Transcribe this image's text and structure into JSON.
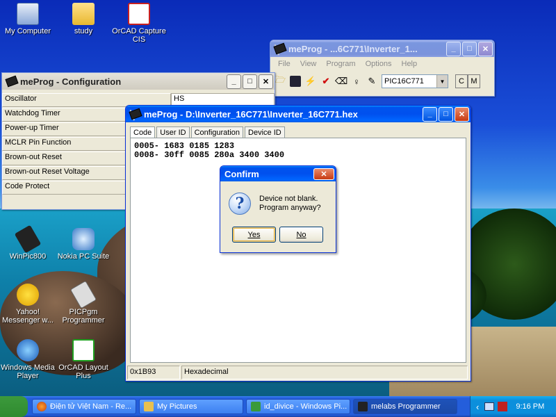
{
  "desktop": {
    "icons": [
      {
        "label": "My Computer"
      },
      {
        "label": "study"
      },
      {
        "label": "OrCAD Capture CIS"
      },
      {
        "label": "WinPic800"
      },
      {
        "label": "Nokia PC Suite"
      },
      {
        "label": "Yahoo! Messenger w..."
      },
      {
        "label": "PICPgm Programmer"
      },
      {
        "label": "Windows Media Player"
      },
      {
        "label": "OrCAD Layout Plus"
      }
    ]
  },
  "toolbar_window": {
    "title": "meProg - ...6C771\\Inverter_1...",
    "menu": [
      "File",
      "View",
      "Program",
      "Options",
      "Help"
    ],
    "device": "PIC16C771",
    "btn_c": "C",
    "btn_m": "M"
  },
  "config_window": {
    "title": "meProg - Configuration",
    "rows": [
      {
        "label": "Oscillator",
        "value": "HS"
      },
      {
        "label": "Watchdog Timer",
        "value": ""
      },
      {
        "label": "Power-up Timer",
        "value": ""
      },
      {
        "label": "MCLR Pin Function",
        "value": ""
      },
      {
        "label": "Brown-out Reset",
        "value": ""
      },
      {
        "label": "Brown-out Reset Voltage",
        "value": ""
      },
      {
        "label": "Code Protect",
        "value": ""
      }
    ]
  },
  "hex_window": {
    "title": "meProg - D:\\Inverter_16C771\\Inverter_16C771.hex",
    "tabs": [
      "Code",
      "User ID",
      "Configuration",
      "Device ID"
    ],
    "code_lines": [
      "0005- 1683 0185 1283",
      "0008- 30ff 0085 280a 3400 3400"
    ],
    "status": {
      "address": "0x1B93",
      "format": "Hexadecimal"
    }
  },
  "dialog": {
    "title": "Confirm",
    "message_line1": "Device not blank.",
    "message_line2": "Program anyway?",
    "yes": "Yes",
    "no": "No"
  },
  "taskbar": {
    "items": [
      {
        "label": "Điện tử Việt Nam - Re..."
      },
      {
        "label": "My Pictures"
      },
      {
        "label": "id_divice - Windows Pi..."
      },
      {
        "label": "melabs Programmer"
      }
    ],
    "clock": "9:16 PM"
  },
  "colors": {
    "accent": "#0053ee",
    "desktop_sky": "#1a4fd8"
  }
}
